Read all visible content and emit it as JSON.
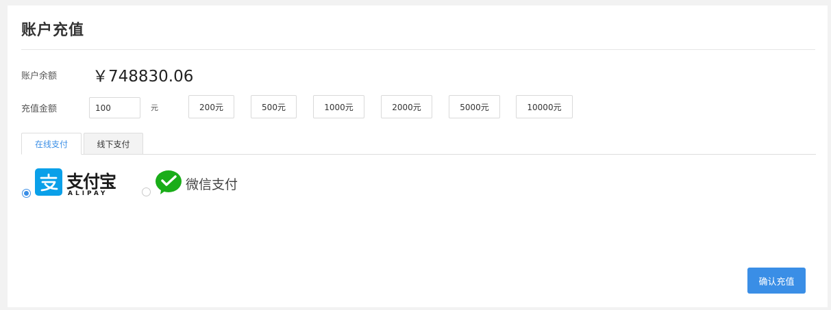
{
  "page": {
    "title": "账户充值"
  },
  "balance": {
    "label": "账户余额",
    "value": "￥748830.06"
  },
  "recharge": {
    "label": "充值金额",
    "amount_value": "100",
    "unit": "元",
    "presets": [
      "200元",
      "500元",
      "1000元",
      "2000元",
      "5000元",
      "10000元"
    ]
  },
  "tabs": [
    {
      "label": "在线支付",
      "active": true
    },
    {
      "label": "线下支付",
      "active": false
    }
  ],
  "payment_methods": {
    "alipay": {
      "name": "支付宝",
      "sub": "ALIPAY",
      "selected": true,
      "icon": "alipay-icon"
    },
    "wechat": {
      "name": "微信支付",
      "selected": false,
      "icon": "wechat-pay-icon"
    }
  },
  "actions": {
    "confirm_label": "确认充值"
  },
  "colors": {
    "accent": "#3a8ee6",
    "alipay": "#0aa0e9",
    "wechat": "#1aad19"
  }
}
